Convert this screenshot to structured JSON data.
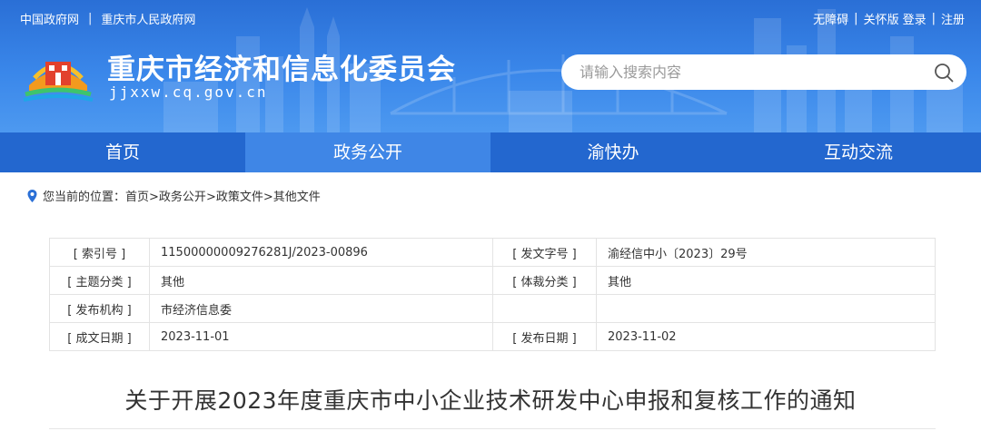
{
  "top_links_left": [
    "中国政府网",
    "重庆市人民政府网"
  ],
  "top_links_right": [
    "无障碍",
    "关怀版",
    "登录",
    "注册"
  ],
  "site": {
    "title": "重庆市经济和信息化委员会",
    "domain": "jjxxw.cq.gov.cn"
  },
  "search": {
    "placeholder": "请输入搜索内容"
  },
  "nav": [
    "首页",
    "政务公开",
    "渝快办",
    "互动交流"
  ],
  "nav_active": "政务公开",
  "breadcrumb": {
    "prefix": "您当前的位置：",
    "items": [
      "首页",
      " >政务公开",
      " >政策文件",
      " >其他文件"
    ]
  },
  "info": {
    "index_label": "[ 索引号 ]",
    "index_value": "11500000009276281J/2023-00896",
    "docno_label": "[ 发文字号 ]",
    "docno_value": "渝经信中小〔2023〕29号",
    "topic_label": "[ 主题分类 ]",
    "topic_value": "其他",
    "genre_label": "[ 体裁分类 ]",
    "genre_value": "其他",
    "org_label": "[ 发布机构 ]",
    "org_value": "市经济信息委",
    "created_label": "[ 成文日期 ]",
    "created_value": "2023-11-01",
    "published_label": "[ 发布日期 ]",
    "published_value": "2023-11-02"
  },
  "doc_title": "关于开展2023年度重庆市中小企业技术研发中心申报和复核工作的通知",
  "colors": {
    "header": "#3a87ea",
    "nav": "#2367cf",
    "nav_active": "#3f86e6"
  }
}
